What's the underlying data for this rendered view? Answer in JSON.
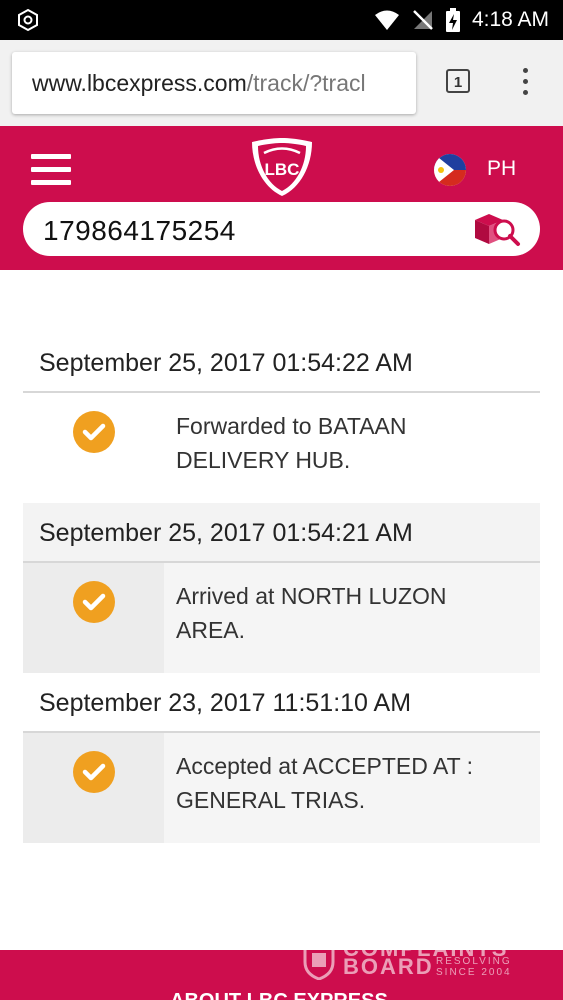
{
  "status_bar": {
    "time": "4:18 AM"
  },
  "browser": {
    "url_host": "www.lbcexpress.com",
    "url_path": "/track/?tracl",
    "tab_count": "1"
  },
  "header": {
    "logo_text": "LBC",
    "country": "PH"
  },
  "search": {
    "tracking_number": "179864175254"
  },
  "timeline": [
    {
      "date": "September 25, 2017 01:54:22 AM",
      "line1": "Forwarded to BATAAN",
      "line2": "DELIVERY HUB."
    },
    {
      "date": "September 25, 2017 01:54:21 AM",
      "line1": "Arrived at NORTH LUZON",
      "line2": "AREA."
    },
    {
      "date": "September 23, 2017 11:51:10 AM",
      "line1": "Accepted at ACCEPTED AT :",
      "line2": "GENERAL TRIAS."
    }
  ],
  "footer": {
    "about": "ABOUT LBC EXPRESS",
    "watermark_1": "COMPLAINTS",
    "watermark_2": "BOARD",
    "watermark_3": "RESOLVING",
    "watermark_4": "SINCE 2004"
  },
  "colors": {
    "brand": "#cd0d4d",
    "check": "#f0a020"
  }
}
